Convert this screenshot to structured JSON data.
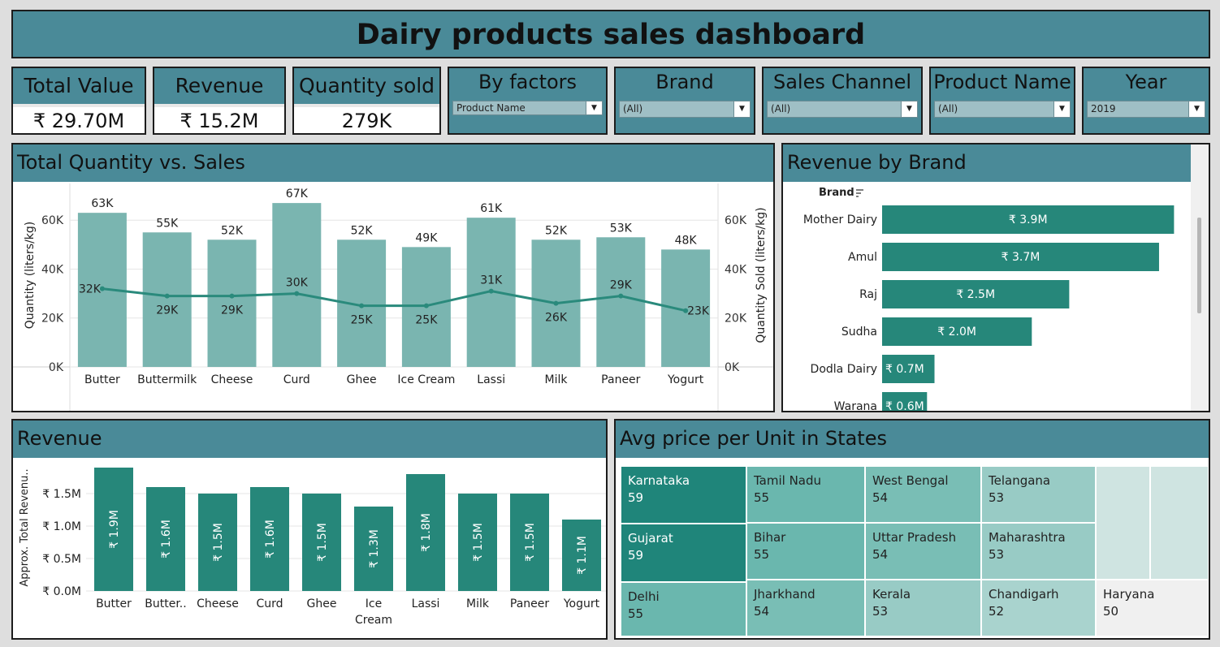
{
  "title": "Dairy products sales dashboard",
  "kpis": [
    {
      "label": "Total Value",
      "value": "₹ 29.70M"
    },
    {
      "label": "Revenue",
      "value": "₹ 15.2M"
    },
    {
      "label": "Quantity sold",
      "value": "279K"
    }
  ],
  "filters": [
    {
      "label": "By factors",
      "value": "Product Name"
    },
    {
      "label": "Brand",
      "value": "(All)"
    },
    {
      "label": "Sales Channel",
      "value": "(All)"
    },
    {
      "label": "Product Name",
      "value": "(All)"
    },
    {
      "label": "Year",
      "value": "2019"
    }
  ],
  "panels": {
    "qty_sales": "Total Quantity vs. Sales",
    "brand": "Revenue by Brand",
    "revenue": "Revenue",
    "states": "Avg price per Unit in States"
  },
  "colors": {
    "header": "#4a8a98",
    "bar_light": "#7ab5b0",
    "bar_dark": "#26877a",
    "line": "#2a8a7c"
  },
  "chart_data": [
    {
      "type": "bar",
      "title": "Total Quantity vs. Sales",
      "categories": [
        "Butter",
        "Buttermilk",
        "Cheese",
        "Curd",
        "Ghee",
        "Ice Cream",
        "Lassi",
        "Milk",
        "Paneer",
        "Yogurt"
      ],
      "series": [
        {
          "values": [
            63,
            55,
            52,
            67,
            52,
            49,
            61,
            52,
            53,
            48
          ],
          "labels": [
            "63K",
            "55K",
            "52K",
            "67K",
            "52K",
            "49K",
            "61K",
            "52K",
            "53K",
            "48K"
          ]
        },
        {
          "type": "line",
          "values": [
            32,
            29,
            29,
            30,
            25,
            25,
            31,
            26,
            29,
            23
          ],
          "labels": [
            "32K",
            "29K",
            "29K",
            "30K",
            "25K",
            "25K",
            "31K",
            "26K",
            "29K",
            "23K"
          ]
        }
      ],
      "ylabel": "Quantity (liters/kg)",
      "y2label": "Quantity Sold (liters/kg)",
      "yticks": [
        "0K",
        "20K",
        "40K",
        "60K"
      ],
      "ylim": [
        0,
        75
      ]
    },
    {
      "type": "bar",
      "title": "Revenue by Brand",
      "axis_header": "Brand",
      "categories": [
        "Mother Dairy",
        "Amul",
        "Raj",
        "Sudha",
        "Dodla Dairy",
        "Warana"
      ],
      "values": [
        3.9,
        3.7,
        2.5,
        2.0,
        0.7,
        0.6
      ],
      "labels": [
        "₹ 3.9M",
        "₹ 3.7M",
        "₹ 2.5M",
        "₹ 2.0M",
        "₹ 0.7M",
        "₹ 0.6M"
      ],
      "xlim": [
        0,
        3.95
      ]
    },
    {
      "type": "bar",
      "title": "Revenue",
      "categories": [
        "Butter",
        "Butter..",
        "Cheese",
        "Curd",
        "Ghee",
        "Ice Cream",
        "Lassi",
        "Milk",
        "Paneer",
        "Yogurt"
      ],
      "values": [
        1.9,
        1.6,
        1.5,
        1.6,
        1.5,
        1.3,
        1.8,
        1.5,
        1.5,
        1.1
      ],
      "labels": [
        "₹ 1.9M",
        "₹ 1.6M",
        "₹ 1.5M",
        "₹ 1.6M",
        "₹ 1.5M",
        "₹ 1.3M",
        "₹ 1.8M",
        "₹ 1.5M",
        "₹ 1.5M",
        "₹ 1.1M"
      ],
      "ylabel": "Approx. Total Revenu..",
      "yticks": [
        "₹ 0.0M",
        "₹ 0.5M",
        "₹ 1.0M",
        "₹ 1.5M"
      ],
      "ylim": [
        0,
        1.9
      ]
    },
    {
      "type": "heatmap",
      "title": "Avg price per Unit in States",
      "cells": [
        {
          "name": "Karnataka",
          "value": "59"
        },
        {
          "name": "Gujarat",
          "value": "59"
        },
        {
          "name": "Delhi",
          "value": "55"
        },
        {
          "name": "Tamil Nadu",
          "value": "55"
        },
        {
          "name": "Bihar",
          "value": "55"
        },
        {
          "name": "Jharkhand",
          "value": "54"
        },
        {
          "name": "West Bengal",
          "value": "54"
        },
        {
          "name": "Uttar Pradesh",
          "value": "54"
        },
        {
          "name": "Kerala",
          "value": "53"
        },
        {
          "name": "Telangana",
          "value": "53"
        },
        {
          "name": "Maharashtra",
          "value": "53"
        },
        {
          "name": "Chandigarh",
          "value": "52"
        },
        {
          "name": "Haryana",
          "value": "50"
        }
      ]
    }
  ]
}
